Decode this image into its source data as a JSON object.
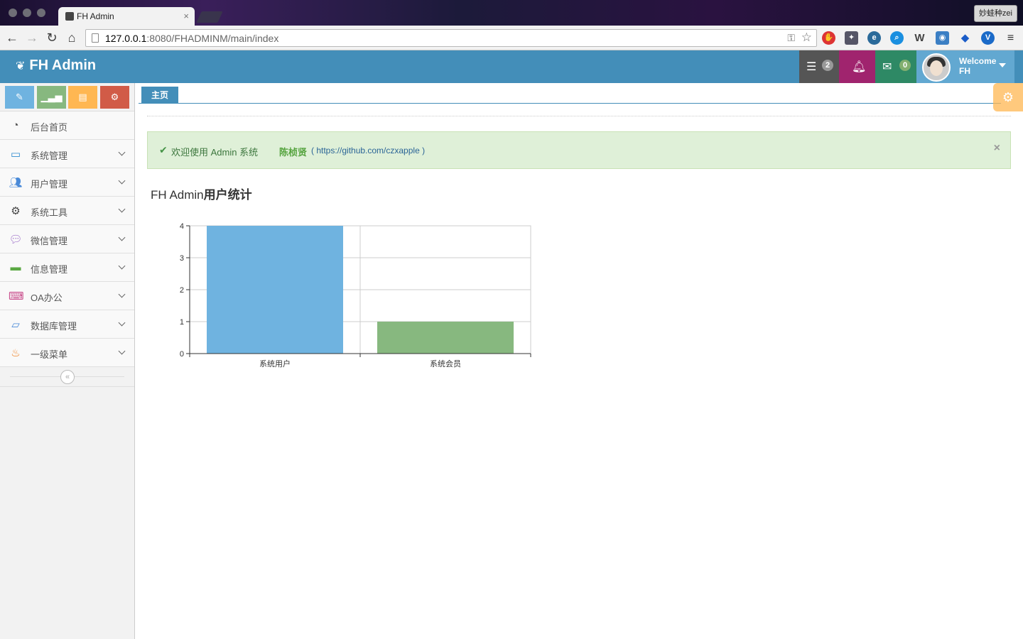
{
  "browser": {
    "tab_title": "FH Admin",
    "url_host": "127.0.0.1",
    "url_rest": ":8080/FHADMINM/main/index",
    "profile_name": "妙蛙种zei"
  },
  "navbar": {
    "brand": "FH Admin",
    "tasks_count": "2",
    "messages_count": "0",
    "welcome": "Welcome",
    "username": "FH",
    "colors": {
      "bar": "#438eb9",
      "tasks": "#555555",
      "notifications": "#a0246e",
      "messages": "#2e8965",
      "user": "#62a8d1"
    }
  },
  "sidebar": {
    "shortcut_icons": [
      "pencil-icon",
      "signal-icon",
      "book-icon",
      "cogs-icon"
    ],
    "items": [
      {
        "label": "后台首页",
        "icon": "dashboard-icon"
      },
      {
        "label": "系统管理",
        "icon": "desktop-icon"
      },
      {
        "label": "用户管理",
        "icon": "users-icon"
      },
      {
        "label": "系统工具",
        "icon": "cog-icon"
      },
      {
        "label": "微信管理",
        "icon": "comments-icon"
      },
      {
        "label": "信息管理",
        "icon": "credit-card-icon"
      },
      {
        "label": "OA办公",
        "icon": "laptop-icon"
      },
      {
        "label": "数据库管理",
        "icon": "hdd-icon"
      },
      {
        "label": "一级菜单",
        "icon": "fire-icon"
      }
    ]
  },
  "tabs": {
    "home": "主页"
  },
  "alert": {
    "message": "欢迎使用 Admin 系统",
    "author": "陈桢贤",
    "link": "( https://github.com/czxapple )"
  },
  "chart_title_prefix": "FH Admin",
  "chart_title_suffix": "用户统计",
  "chart_data": {
    "type": "bar",
    "categories": [
      "系统用户",
      "系统会员"
    ],
    "values": [
      4,
      1
    ],
    "colors": [
      "#6fb3e0",
      "#87b87f"
    ],
    "ylim": [
      0,
      4
    ],
    "yticks": [
      0,
      1,
      2,
      3,
      4
    ],
    "grid": true
  }
}
